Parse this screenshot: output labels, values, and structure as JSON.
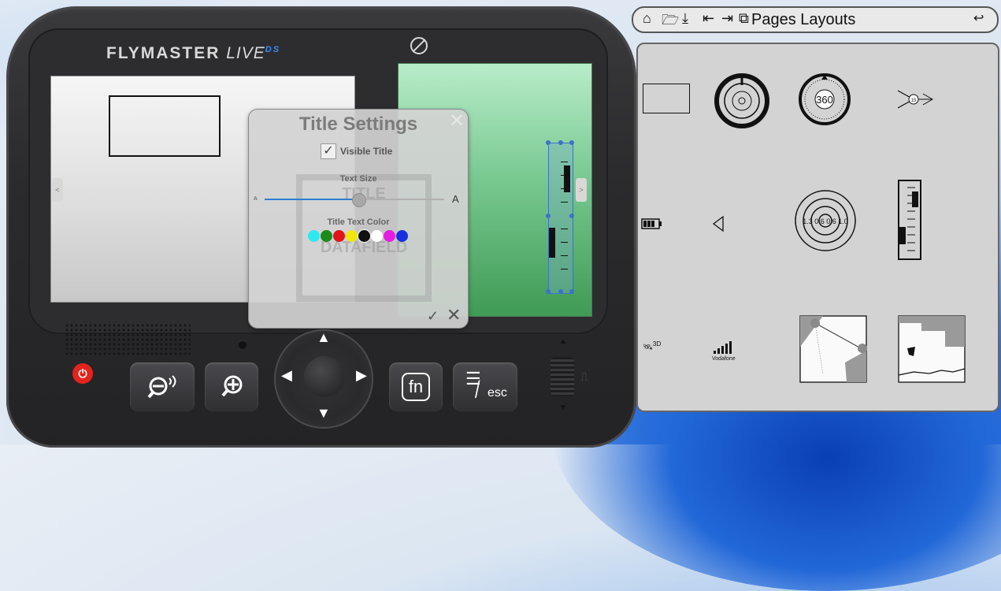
{
  "device": {
    "brand": "FLYMASTER",
    "model": "LIVE",
    "model_suffix": "DS"
  },
  "dialog": {
    "title": "Title Settings",
    "visible_title_label": "Visible Title",
    "visible_title_checked": true,
    "text_size_label": "Text Size",
    "text_size_min": "A",
    "text_size_max": "A",
    "text_size_value": 0.52,
    "color_label": "Title Text Color",
    "colors": [
      "#2ee8f0",
      "#1a8a1a",
      "#e0141b",
      "#f2e60c",
      "#111111",
      "#ffffff",
      "#e51ee0",
      "#1730e0"
    ],
    "selected_color_index": 4,
    "ghost_title": "TITLE",
    "ghost_data": "DATAFIELD",
    "ok_icon": "checkmark",
    "close_icon": "close-x"
  },
  "buttons": {
    "fn_label": "fn",
    "esc_label": "esc"
  },
  "pages_layouts": {
    "title": "Pages Layouts",
    "toolbar_icons": [
      "home-pages-icon",
      "open-folder-icon",
      "download-icon",
      "import-icon",
      "export-icon",
      "pages-icon"
    ],
    "back_icon": "undo-icon",
    "items": [
      {
        "name": "rectangle-widget"
      },
      {
        "name": "compass-widget"
      },
      {
        "name": "heading-360-widget",
        "text": "360"
      },
      {
        "name": "wind-arrow-widget",
        "text": "15"
      },
      {
        "name": "battery-widget"
      },
      {
        "name": "sound-widget"
      },
      {
        "name": "vario-rings-widget",
        "text": "1.3 0.6 0.6 1.0"
      },
      {
        "name": "vertical-slider-widget"
      },
      {
        "name": "gps-3d-widget",
        "text": "3D"
      },
      {
        "name": "signal-widget",
        "text": "Vodafone"
      },
      {
        "name": "map-widget"
      },
      {
        "name": "terrain-widget"
      }
    ]
  }
}
